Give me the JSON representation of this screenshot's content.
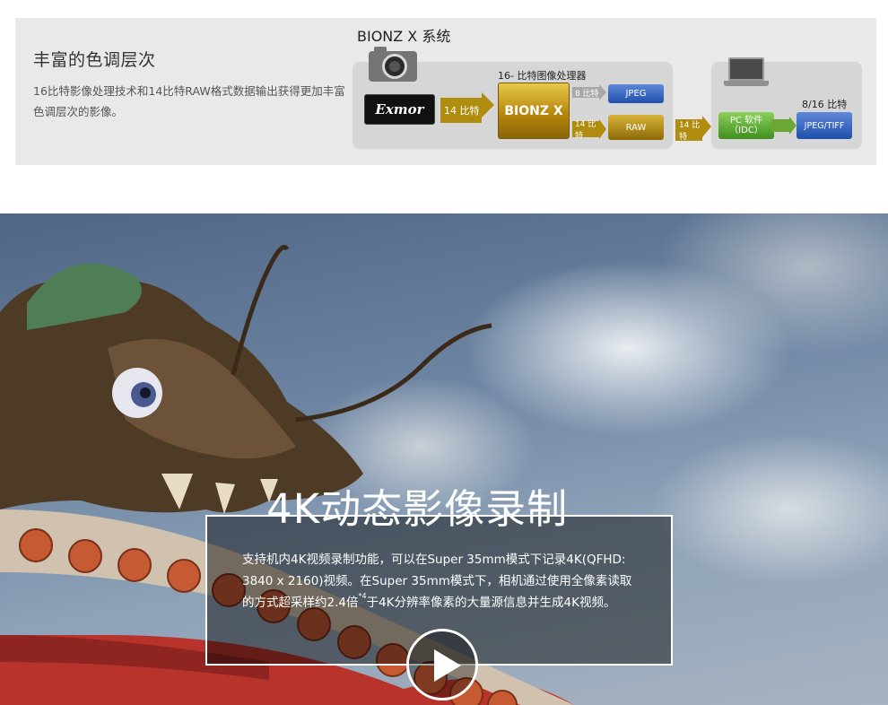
{
  "feature": {
    "title": "丰富的色调层次",
    "description": "16比特影像处理技术和14比特RAW格式数据输出获得更加丰富色调层次的影像。"
  },
  "diagram": {
    "system_title": "BIONZ X 系统",
    "processor_label": "16- 比特图像处理器",
    "sensor_label": "Exmor",
    "processor_chip": "BIONZ X",
    "arrow_14bit_1": "14 比特",
    "arrow_8bit": "8 比特",
    "arrow_14bit_2": "14 比特",
    "arrow_14bit_3": "14 比特",
    "jpeg": "JPEG",
    "raw": "RAW",
    "pc_software": "PC 软件",
    "pc_software_sub": "（IDC）",
    "output_bits": "8/16 比特",
    "output_format": "JPEG/TIFF",
    "icons": [
      "camera-icon",
      "laptop-icon"
    ],
    "colors": {
      "gold": "#b08d0e",
      "blue": "#1f4fae",
      "green": "#3f8f1f"
    }
  },
  "hero": {
    "title": "4K动态影像录制",
    "desc_part1": "支持机内4K视频录制功能，可以在Super 35mm模式下记录4K(QFHD: 3840 x 2160)视频。在Super 35mm模式下，相机通过使用全像素读取的方式超采样约2.4倍",
    "desc_sup": "*4",
    "desc_part2": "于4K分辨率像素的大量源信息并生成4K视频。",
    "play_icon": "play-icon"
  }
}
